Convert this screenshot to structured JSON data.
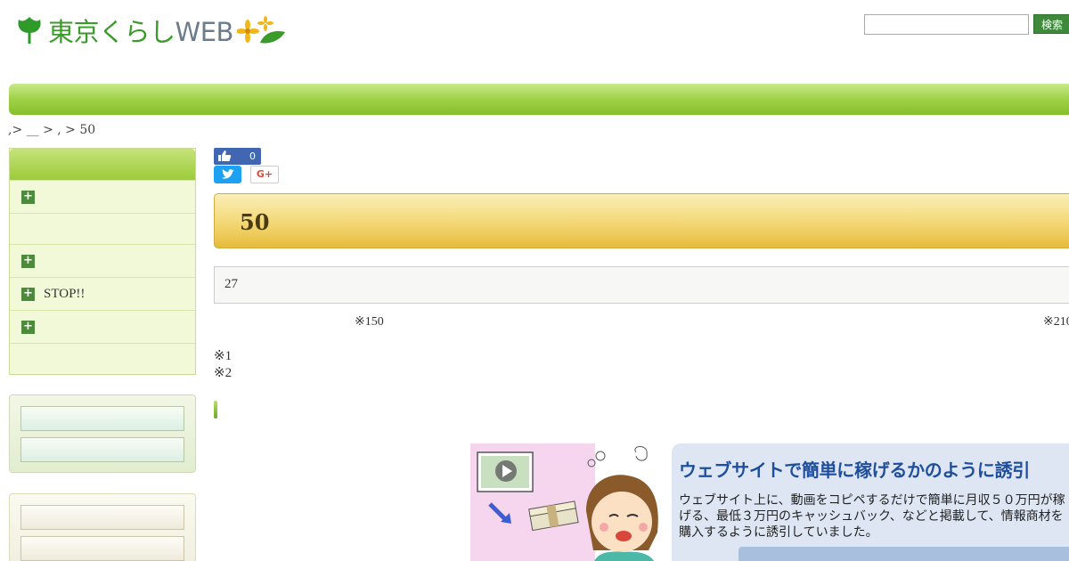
{
  "header": {
    "logo_text_jp": "東京くらし",
    "logo_text_web": "WEB",
    "search_placeholder": "",
    "search_button": "検索"
  },
  "breadcrumb": ",> __ > , > 50",
  "sidebar": {
    "items": [
      {
        "label": "",
        "has_plus": true
      },
      {
        "label": "",
        "has_plus": false
      },
      {
        "label": "",
        "has_plus": true
      },
      {
        "label": "STOP!!",
        "has_plus": true
      },
      {
        "label": "",
        "has_plus": true
      },
      {
        "label": "",
        "has_plus": false
      }
    ]
  },
  "social": {
    "like_count": "0",
    "gplus_label": "G+"
  },
  "article": {
    "title": "50",
    "info_text": "27",
    "note_150": "※150",
    "note_210": "※210",
    "note_1": "※1",
    "note_2": "※2"
  },
  "panel": {
    "title": "ウェブサイトで簡単に稼げるかのように誘引",
    "body": "ウェブサイト上に、動画をコピペするだけで簡単に月収５０万円が稼げる、最低３万円のキャッシュバック、などと掲載して、情報商材を購入するように誘引していました。"
  },
  "colors": {
    "brand_green": "#3a9a2a",
    "nav_green": "#9fd146",
    "title_gold": "#f3d774",
    "panel_blue": "#1f4f9c"
  }
}
